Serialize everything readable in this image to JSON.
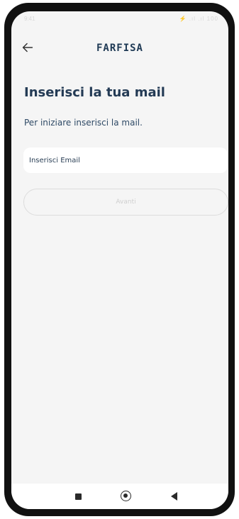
{
  "status_bar": {
    "time": "9:41",
    "icons": "⚡ .ıl .ıl 100"
  },
  "app_bar": {
    "back_icon": "arrow-left-icon",
    "brand": "FARFISA"
  },
  "main": {
    "title": "Inserisci la tua mail",
    "subtitle": "Per iniziare inserisci la mail.",
    "email": {
      "value": "",
      "placeholder": "Inserisci Email"
    },
    "next_label": "Avanti"
  },
  "nav_bar": {
    "recent_icon": "square-icon",
    "home_icon": "circle-icon",
    "back_icon": "triangle-back-icon"
  },
  "colors": {
    "background": "#f5f5f5",
    "primary_text": "#243b55",
    "input_bg": "#ffffff",
    "disabled_text": "#cfcfcf"
  }
}
